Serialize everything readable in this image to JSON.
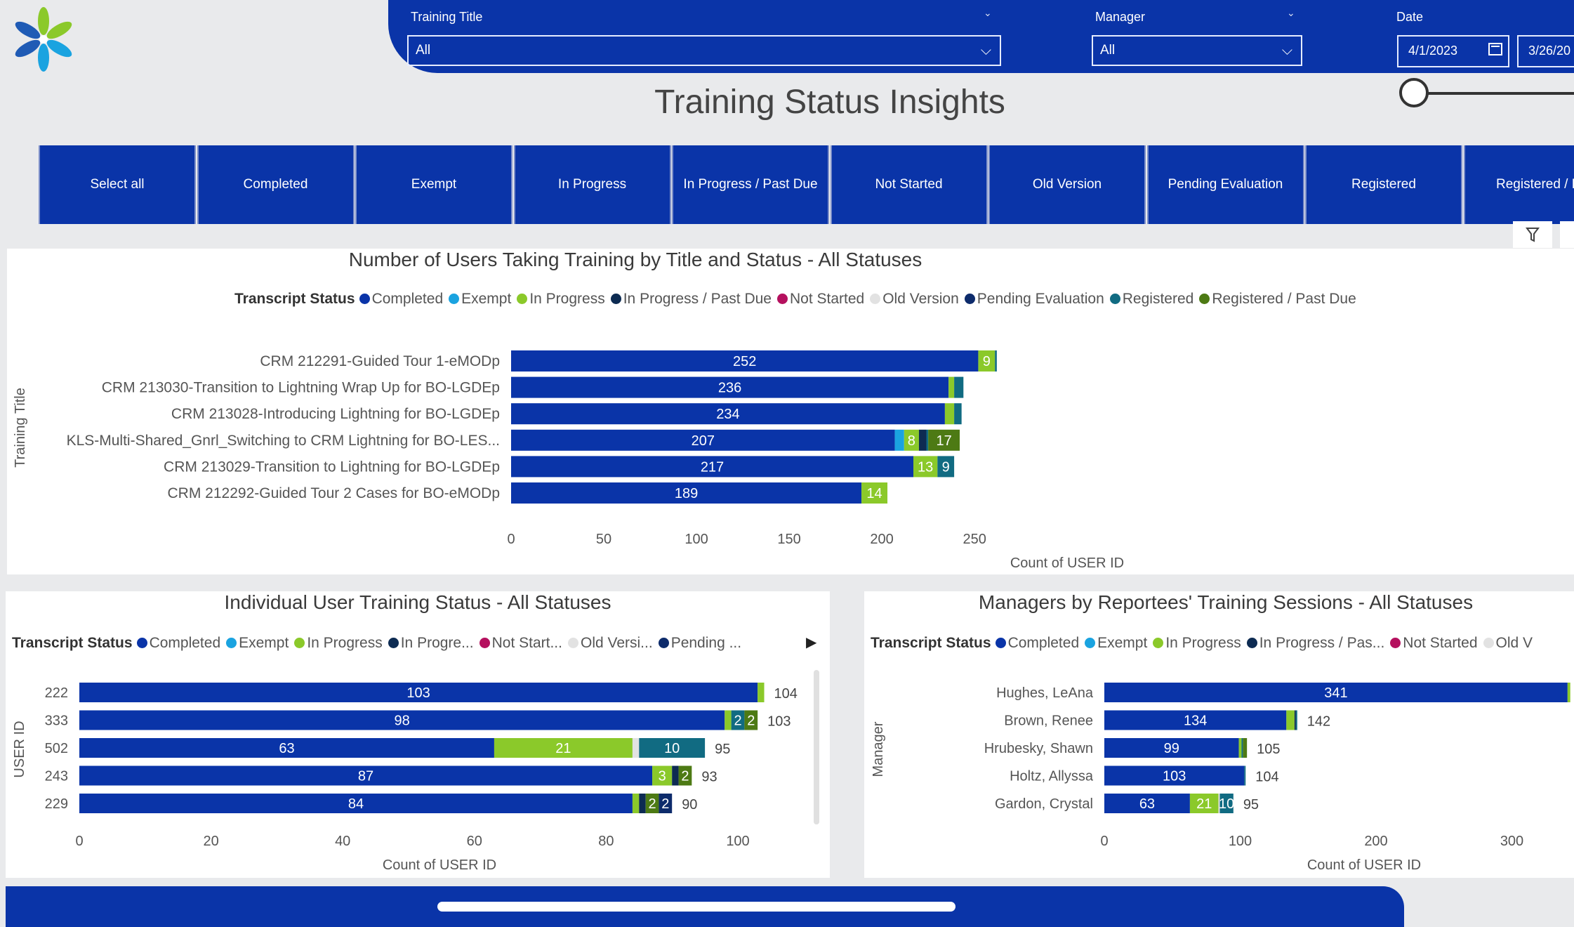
{
  "colors": {
    "Completed": "#0a34a8",
    "Exempt": "#1aa3e0",
    "In Progress": "#8bc92a",
    "In Progress / Past Due": "#0d2b52",
    "Not Started": "#b5105e",
    "Old Version": "#e2e2e2",
    "Pending Evaluation": "#0d2b6b",
    "Registered": "#116b82",
    "Registered / Past Due": "#4d7a14",
    "brand_blue": "#0a34a8"
  },
  "filters": {
    "training_title": {
      "label": "Training Title",
      "value": "All"
    },
    "manager": {
      "label": "Manager",
      "value": "All"
    },
    "date": {
      "label": "Date",
      "start": "4/1/2023",
      "end": "3/26/20"
    }
  },
  "page_title": "Training Status Insights",
  "status_buttons": [
    "Select all",
    "Completed",
    "Exempt",
    "In Progress",
    "In Progress / Past Due",
    "Not Started",
    "Old Version",
    "Pending Evaluation",
    "Registered",
    "Registered / Pa"
  ],
  "chart_main": {
    "title": "Number of Users Taking Training by Title and Status - All Statuses",
    "legend_title": "Transcript Status",
    "legend": [
      "Completed",
      "Exempt",
      "In Progress",
      "In Progress / Past Due",
      "Not Started",
      "Old Version",
      "Pending Evaluation",
      "Registered",
      "Registered / Past Due"
    ],
    "y_axis_label": "Training Title",
    "x_axis_label": "Count of USER ID",
    "x_ticks": [
      "0",
      "50",
      "100",
      "150",
      "200",
      "250"
    ]
  },
  "chart_users": {
    "title": "Individual User Training Status - All Statuses",
    "legend_title": "Transcript Status",
    "legend": [
      "Completed",
      "Exempt",
      "In Progress",
      "In Progre...",
      "Not Start...",
      "Old Versi...",
      "Pending ..."
    ],
    "y_axis_label": "USER ID",
    "x_axis_label": "Count of USER ID",
    "x_ticks": [
      "0",
      "20",
      "40",
      "60",
      "80",
      "100"
    ]
  },
  "chart_managers": {
    "title": "Managers by Reportees' Training Sessions - All Statuses",
    "legend_title": "Transcript Status",
    "legend": [
      "Completed",
      "Exempt",
      "In Progress",
      "In Progress / Pas...",
      "Not Started",
      "Old V"
    ],
    "y_axis_label": "Manager",
    "x_axis_label": "Count of USER ID",
    "x_ticks": [
      "0",
      "100",
      "200",
      "300"
    ]
  },
  "chart_data": [
    {
      "type": "bar",
      "title": "Number of Users Taking Training by Title and Status - All Statuses",
      "orientation": "horizontal",
      "stacked": true,
      "xlabel": "Count of USER ID",
      "ylabel": "Training Title",
      "xlim": [
        0,
        280
      ],
      "categories": [
        "CRM 212291-Guided Tour 1-eMODp",
        "CRM 213030-Transition to Lightning Wrap Up for BO-LGDEp",
        "CRM 213028-Introducing Lightning for BO-LGDEp",
        "KLS-Multi-Shared_Gnrl_Switching to CRM Lightning for BO-LES...",
        "CRM 213029-Transition to Lightning for BO-LGDEp",
        "CRM 212292-Guided Tour 2 Cases for BO-eMODp"
      ],
      "series": [
        {
          "name": "Completed",
          "values": [
            252,
            236,
            234,
            207,
            217,
            189
          ]
        },
        {
          "name": "Exempt",
          "values": [
            0,
            0,
            0,
            5,
            0,
            0
          ]
        },
        {
          "name": "Old Version",
          "values": [
            0,
            0,
            0,
            0,
            0,
            0
          ]
        },
        {
          "name": "In Progress",
          "values": [
            9,
            3,
            5,
            8,
            13,
            14
          ]
        },
        {
          "name": "In Progress / Past Due",
          "values": [
            0,
            0,
            0,
            4,
            0,
            0
          ]
        },
        {
          "name": "Registered",
          "values": [
            1,
            5,
            4,
            1,
            9,
            0
          ]
        },
        {
          "name": "Registered / Past Due",
          "values": [
            0,
            0,
            0,
            17,
            0,
            0
          ]
        }
      ]
    },
    {
      "type": "bar",
      "title": "Individual User Training Status - All Statuses",
      "orientation": "horizontal",
      "stacked": true,
      "xlabel": "Count of USER ID",
      "ylabel": "USER ID",
      "xlim": [
        0,
        110
      ],
      "categories": [
        "222",
        "333",
        "502",
        "243",
        "229"
      ],
      "totals": [
        104,
        103,
        95,
        93,
        90
      ],
      "series": [
        {
          "name": "Completed",
          "values": [
            103,
            98,
            63,
            87,
            84
          ]
        },
        {
          "name": "In Progress",
          "values": [
            1,
            1,
            21,
            3,
            1
          ]
        },
        {
          "name": "Old Version",
          "values": [
            0,
            0,
            1,
            0,
            0
          ]
        },
        {
          "name": "In Progress / Past Due",
          "values": [
            0,
            0,
            0,
            1,
            1
          ]
        },
        {
          "name": "Registered",
          "values": [
            0,
            2,
            10,
            0,
            0
          ]
        },
        {
          "name": "Registered / Past Due",
          "values": [
            0,
            2,
            0,
            2,
            2
          ]
        },
        {
          "name": "Pending Evaluation",
          "values": [
            0,
            0,
            0,
            0,
            2
          ]
        }
      ]
    },
    {
      "type": "bar",
      "title": "Managers by Reportees' Training Sessions - All Statuses",
      "orientation": "horizontal",
      "stacked": true,
      "xlabel": "Count of USER ID",
      "ylabel": "Manager",
      "xlim": [
        0,
        345
      ],
      "categories": [
        "Hughes, LeAna",
        "Brown, Renee",
        "Hrubesky, Shawn",
        "Holtz, Allyssa",
        "Gardon, Crystal"
      ],
      "totals": [
        null,
        142,
        105,
        104,
        95
      ],
      "series": [
        {
          "name": "Completed",
          "values": [
            341,
            134,
            99,
            103,
            63
          ]
        },
        {
          "name": "In Progress",
          "values": [
            2,
            6,
            2,
            0,
            21
          ]
        },
        {
          "name": "Old Version",
          "values": [
            0,
            0,
            0,
            0,
            1
          ]
        },
        {
          "name": "In Progress / Past Due",
          "values": [
            0,
            1,
            0,
            0,
            0
          ]
        },
        {
          "name": "Registered",
          "values": [
            0,
            1,
            1,
            1,
            10
          ]
        },
        {
          "name": "Registered / Past Due",
          "values": [
            0,
            0,
            3,
            0,
            0
          ]
        }
      ]
    }
  ]
}
